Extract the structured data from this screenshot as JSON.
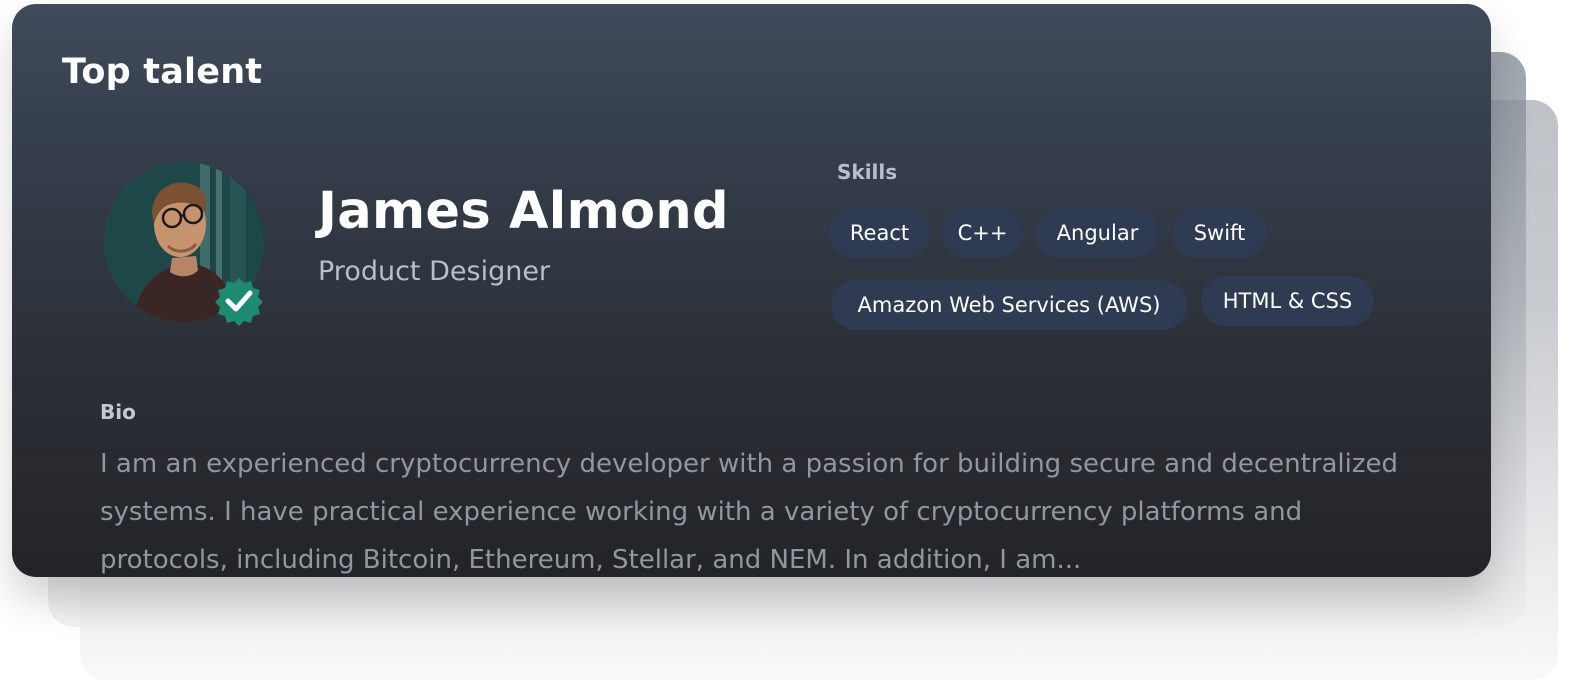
{
  "card": {
    "title": "Top talent"
  },
  "profile": {
    "name": "James Almond",
    "role": "Product Designer",
    "avatar_icon": "person-photo",
    "verified_icon": "verified-badge-icon",
    "verified_color": "#1d8a72"
  },
  "skills": {
    "label": "Skills",
    "items": [
      "React",
      "C++",
      "Angular",
      "Swift",
      "Amazon Web Services (AWS)",
      "HTML & CSS"
    ]
  },
  "bio": {
    "label": "Bio",
    "text": "I am an experienced cryptocurrency developer with a passion for building secure and decentralized systems. I have practical experience working with a variety of cryptocurrency platforms and protocols, including Bitcoin, Ethereum, Stellar, and NEM. In addition, I am..."
  },
  "colors": {
    "card_top": "#3f4a5a",
    "card_bottom": "#232427",
    "chip_bg": "#2e3b52",
    "muted_text": "#b7bfca"
  }
}
